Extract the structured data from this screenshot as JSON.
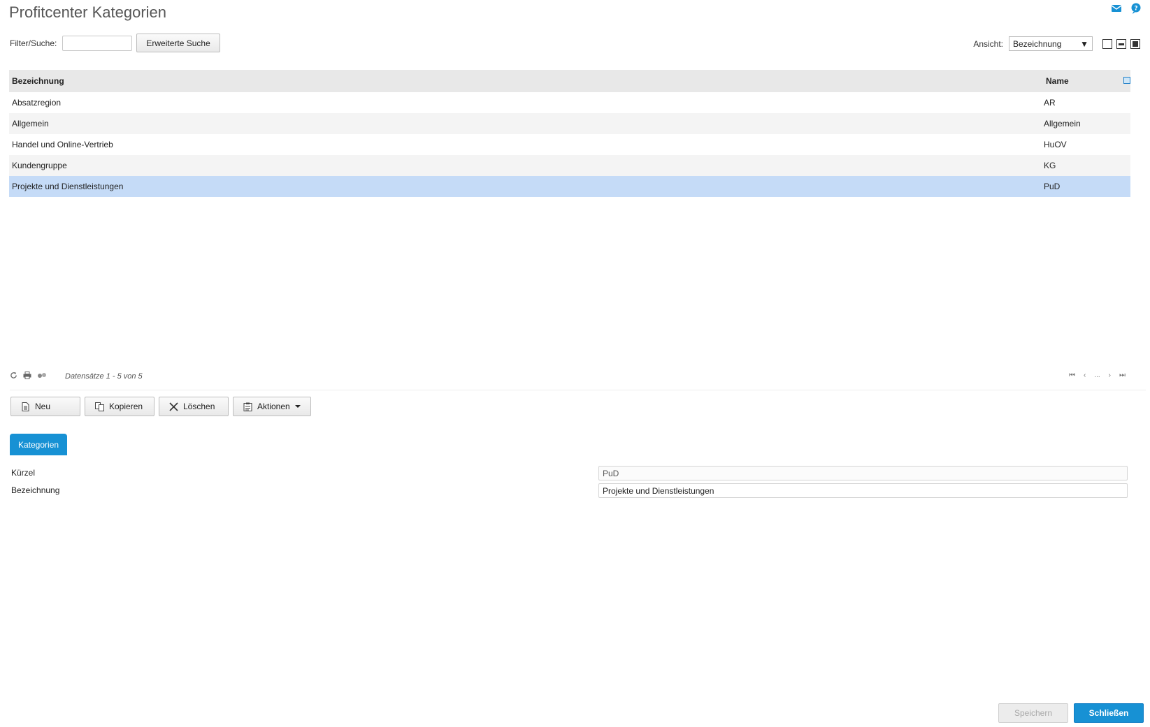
{
  "page": {
    "title": "Profitcenter Kategorien"
  },
  "top_icons": [
    "mail-icon",
    "help-icon"
  ],
  "filter": {
    "label": "Filter/Suche:",
    "value": "",
    "advanced_label": "Erweiterte Suche"
  },
  "view": {
    "label": "Ansicht:",
    "selected": "Bezeichnung"
  },
  "grid": {
    "columns": [
      "Bezeichnung",
      "Name"
    ],
    "rows": [
      {
        "bezeichnung": "Absatzregion",
        "name": "AR"
      },
      {
        "bezeichnung": "Allgemein",
        "name": "Allgemein"
      },
      {
        "bezeichnung": "Handel und Online-Vertrieb",
        "name": "HuOV"
      },
      {
        "bezeichnung": "Kundengruppe",
        "name": "KG"
      },
      {
        "bezeichnung": "Projekte und Dienstleistungen",
        "name": "PuD"
      }
    ],
    "selected_index": 4
  },
  "status": {
    "text": "Datensätze 1 - 5 von 5",
    "pager_ellipsis": "...",
    "icons": [
      "refresh-icon",
      "print-icon",
      "link-icon"
    ]
  },
  "actions": {
    "new_label": "Neu",
    "copy_label": "Kopieren",
    "delete_label": "Löschen",
    "actions_label": "Aktionen"
  },
  "tab": {
    "label": "Kategorien"
  },
  "form": {
    "kuerzel_label": "Kürzel",
    "kuerzel_value": "PuD",
    "bezeichnung_label": "Bezeichnung",
    "bezeichnung_value": "Projekte und Dienstleistungen"
  },
  "footer": {
    "save_label": "Speichern",
    "close_label": "Schließen"
  },
  "colors": {
    "accent": "#1791d4",
    "selection": "#c5dbf7",
    "header_bg": "#e8e8e8"
  }
}
